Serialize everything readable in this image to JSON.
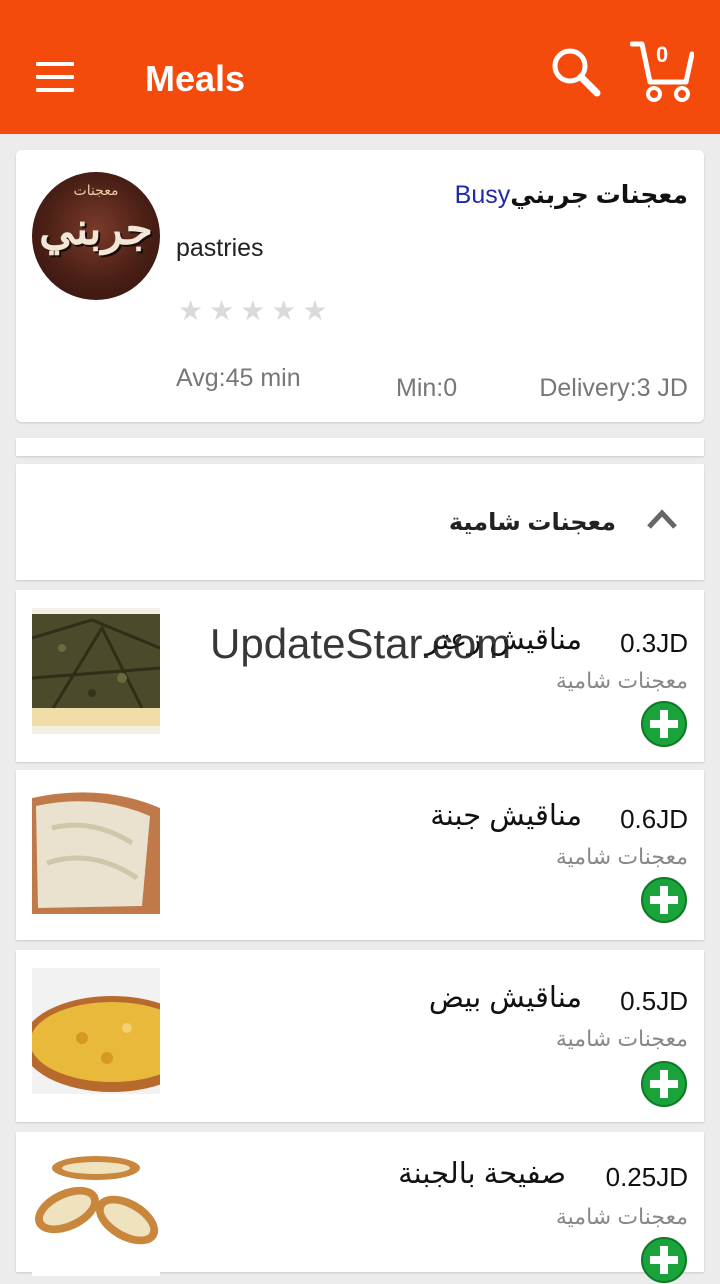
{
  "appbar": {
    "title": "Meals",
    "cart_count": "0"
  },
  "restaurant": {
    "logo_text": "جربني",
    "logo_sub": "معجنات",
    "status": "Busy",
    "name": "معجنات جربني",
    "category": "pastries",
    "rating_stars": "★★★★★",
    "rating_value": 0,
    "avg": "Avg:45 min",
    "min": "Min:0",
    "delivery": "Delivery:3 JD"
  },
  "section": {
    "title": "معجنات شامية",
    "expanded": true
  },
  "items": [
    {
      "name": "مناقيش زعتر",
      "price": "0.3JD",
      "category": "معجنات شامية",
      "image": "zaatar-manakish"
    },
    {
      "name": "مناقيش جبنة",
      "price": "0.6JD",
      "category": "معجنات شامية",
      "image": "cheese-manakish"
    },
    {
      "name": "مناقيش بيض",
      "price": "0.5JD",
      "category": "معجنات شامية",
      "image": "egg-manakish"
    },
    {
      "name": "صفيحة بالجبنة",
      "price": "0.25JD",
      "category": "معجنات شامية",
      "image": "cheese-sfiha"
    }
  ],
  "watermark": "UpdateStar.com",
  "colors": {
    "primary": "#f44a0c",
    "add_green": "#1aa33a",
    "busy_blue": "#1f2aa8"
  }
}
